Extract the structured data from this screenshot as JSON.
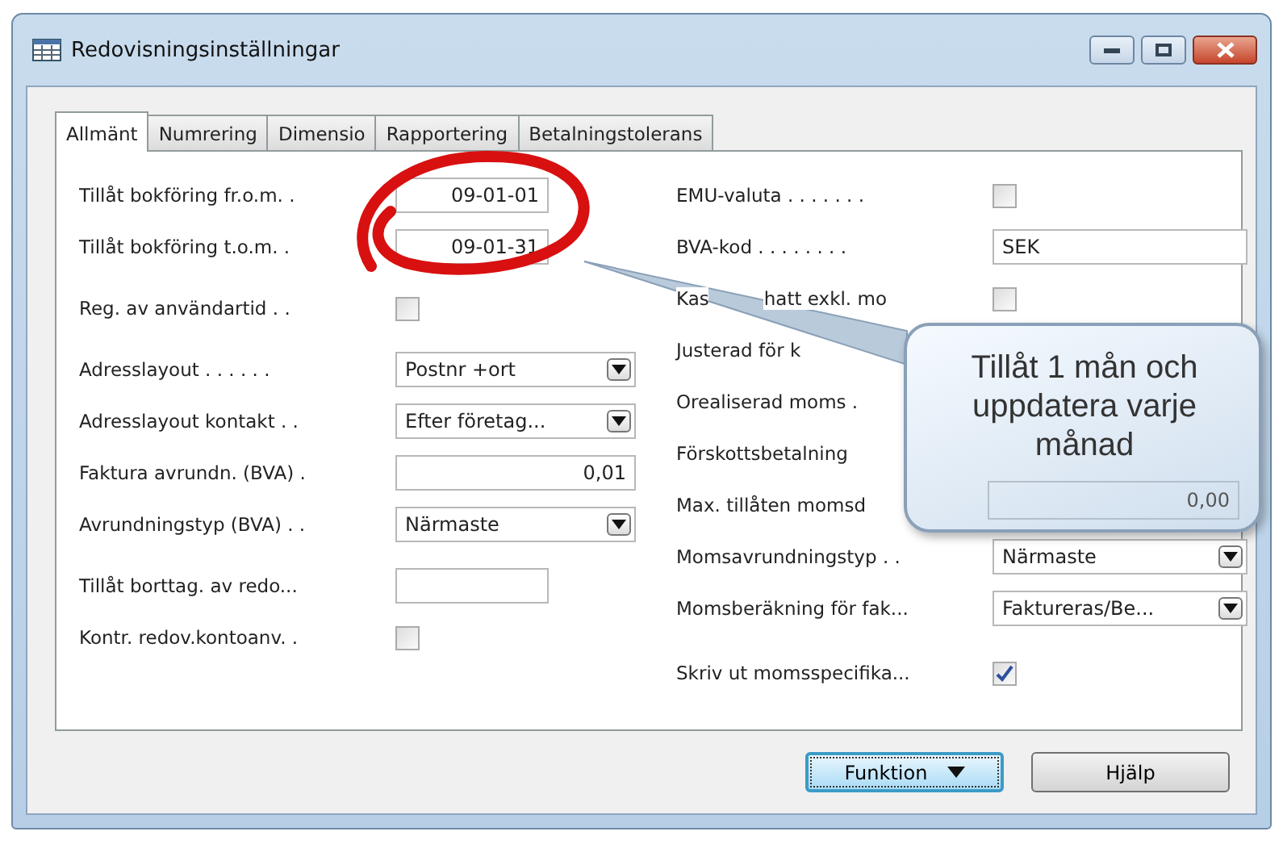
{
  "window": {
    "title": "Redovisningsinställningar"
  },
  "tabs": [
    {
      "label": "Allmänt",
      "selected": true
    },
    {
      "label": "Numrering",
      "selected": false
    },
    {
      "label": "Dimensio",
      "selected": false
    },
    {
      "label": "Rapportering",
      "selected": false
    },
    {
      "label": "Betalningstolerans",
      "selected": false
    }
  ],
  "left_groups": [
    [
      {
        "label": "Tillåt bokföring fr.o.m. .",
        "kind": "date",
        "value": "09-01-01"
      },
      {
        "label": "Tillåt bokföring t.o.m. .",
        "kind": "date",
        "value": "09-01-31"
      }
    ],
    [
      {
        "label": "Reg. av användartid  . .",
        "kind": "checkbox",
        "checked": false
      }
    ],
    [
      {
        "label": "Adresslayout . . . . . .",
        "kind": "dropdown",
        "value": "Postnr +ort"
      },
      {
        "label": "Adresslayout kontakt . .",
        "kind": "dropdown",
        "value": "Efter företag..."
      },
      {
        "label": "Faktura avrundn. (BVA) .",
        "kind": "number",
        "value": "0,01"
      },
      {
        "label": "Avrundningstyp (BVA) . .",
        "kind": "dropdown",
        "value": "Närmaste"
      }
    ],
    [
      {
        "label": "Tillåt borttag. av redo...",
        "kind": "date"
      },
      {
        "label": "Kontr. redov.kontoanv. .",
        "kind": "checkbox",
        "checked": false
      }
    ]
  ],
  "right_rows": [
    {
      "label_parts": [
        "EMU-valuta . . . . . . ."
      ],
      "kind": "checkbox",
      "checked": false
    },
    {
      "label_parts": [
        "BVA-kod  . . . . . . . ."
      ],
      "kind": "text",
      "value": "SEK"
    },
    {
      "label_parts": [
        "Kas",
        "hatt exkl. mo"
      ],
      "kind": "checkbox",
      "checked": false
    },
    {
      "label_parts": [
        "Justerad för k"
      ]
    },
    {
      "label_parts": [
        "Orealiserad moms ."
      ]
    },
    {
      "label_parts": [
        "Förskottsbetalning"
      ]
    },
    {
      "label_parts": [
        "Max. tillåten momsd"
      ],
      "kind": "number",
      "value": "0,00"
    },
    {
      "label_parts": [
        "Momsavrundningstyp  . ."
      ],
      "kind": "dropdown",
      "value": "Närmaste"
    },
    {
      "label_parts": [
        "Momsberäkning för fak..."
      ],
      "kind": "dropdown",
      "value": "Faktureras/Be..."
    },
    {
      "label_parts": [
        "Skriv ut momsspecifika..."
      ],
      "kind": "checkbox",
      "checked": true
    }
  ],
  "callout": {
    "text": "Tillåt 1 mån och uppdatera varje månad"
  },
  "buttons": [
    {
      "label": "Funktion",
      "kind": "menu",
      "focused": true
    },
    {
      "label": "Hjälp",
      "kind": "plain",
      "focused": false
    }
  ]
}
